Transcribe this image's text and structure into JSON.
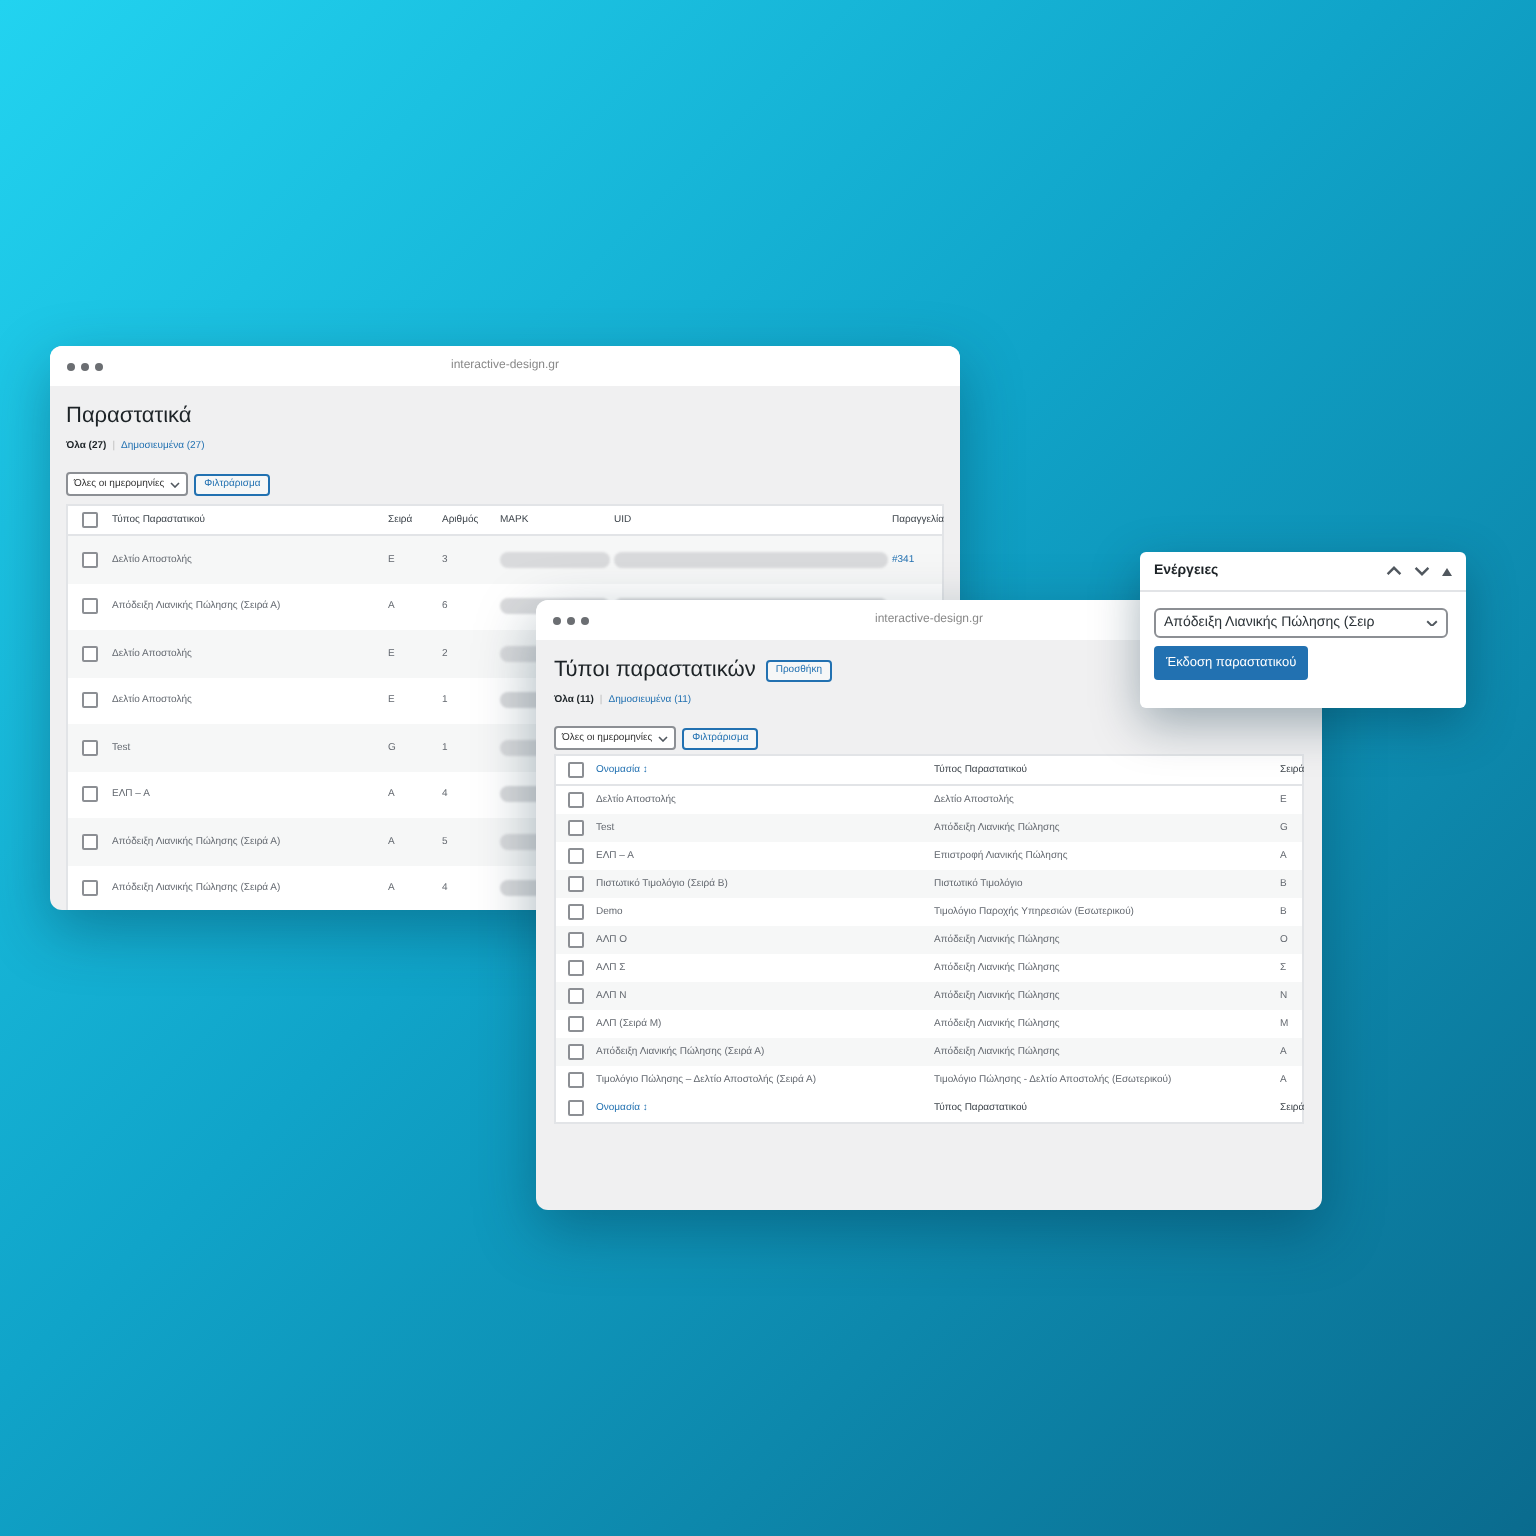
{
  "documents_window": {
    "url": "interactive-design.gr",
    "title": "Παραστατικά",
    "views": [
      {
        "label": "Όλα (27)",
        "selected": true
      },
      {
        "label": "Δημοσιευμένα (27)",
        "selected": false
      }
    ],
    "views_separator": "|",
    "select_all_checked": false,
    "date_filter": "Όλες οι ημερομηνίες",
    "filter_button": "Φιλτράρισμα",
    "columns": [
      "Τύπος Παραστατικού",
      "Σειρά",
      "Αριθμός",
      "ΜΑΡΚ",
      "UID",
      "Παραγγελία"
    ],
    "rows": [
      {
        "type": "Δελτίο Αποστολής",
        "series": "Ε",
        "number": "3",
        "order": "#341",
        "checked": false
      },
      {
        "type": "Απόδειξη Λιανικής Πώλησης (Σειρά Α)",
        "series": "Α",
        "number": "6",
        "checked": false
      },
      {
        "type": "Δελτίο Αποστολής",
        "series": "Ε",
        "number": "2",
        "checked": false
      },
      {
        "type": "Δελτίο Αποστολής",
        "series": "Ε",
        "number": "1",
        "checked": false
      },
      {
        "type": "Test",
        "series": "G",
        "number": "1",
        "checked": false
      },
      {
        "type": "ΕΛΠ – Α",
        "series": "Α",
        "number": "4",
        "checked": false
      },
      {
        "type": "Απόδειξη Λιανικής Πώλησης (Σειρά Α)",
        "series": "Α",
        "number": "5",
        "checked": false
      },
      {
        "type": "Απόδειξη Λιανικής Πώλησης (Σειρά Α)",
        "series": "Α",
        "number": "4",
        "checked": false
      }
    ]
  },
  "types_window": {
    "url": "interactive-design.gr",
    "title": "Τύποι παραστατικών",
    "add_button": "Προσθήκη",
    "views": [
      {
        "label": "Όλα (11)",
        "selected": true
      },
      {
        "label": "Δημοσιευμένα (11)",
        "selected": false
      }
    ],
    "views_separator": "|",
    "select_all_checked": false,
    "footer_select_all_checked": false,
    "date_filter": "Όλες οι ημερομηνίες",
    "filter_button": "Φιλτράρισμα",
    "columns": [
      "Ονομασία ↕",
      "Τύπος Παραστατικού",
      "Σειρά"
    ],
    "rows": [
      {
        "name": "Δελτίο Αποστολής",
        "type": "Δελτίο Αποστολής",
        "series": "Ε",
        "checked": false
      },
      {
        "name": "Test",
        "type": "Απόδειξη Λιανικής Πώλησης",
        "series": "G",
        "checked": false
      },
      {
        "name": "ΕΛΠ – Α",
        "type": "Επιστροφή Λιανικής Πώλησης",
        "series": "Α",
        "checked": false
      },
      {
        "name": "Πιστωτικό Τιμολόγιο (Σειρά Β)",
        "type": "Πιστωτικό Τιμολόγιο",
        "series": "Β",
        "checked": false
      },
      {
        "name": "Demo",
        "type": "Τιμολόγιο Παροχής Υπηρεσιών (Εσωτερικού)",
        "series": "Β",
        "checked": false
      },
      {
        "name": "ΑΛΠ Ο",
        "type": "Απόδειξη Λιανικής Πώλησης",
        "series": "Ο",
        "checked": false
      },
      {
        "name": "ΑΛΠ Σ",
        "type": "Απόδειξη Λιανικής Πώλησης",
        "series": "Σ",
        "checked": false
      },
      {
        "name": "ΑΛΠ Ν",
        "type": "Απόδειξη Λιανικής Πώλησης",
        "series": "Ν",
        "checked": false
      },
      {
        "name": "ΑΛΠ (Σειρά Μ)",
        "type": "Απόδειξη Λιανικής Πώλησης",
        "series": "Μ",
        "checked": false
      },
      {
        "name": "Απόδειξη Λιανικής Πώλησης (Σειρά Α)",
        "type": "Απόδειξη Λιανικής Πώλησης",
        "series": "Α",
        "checked": false
      },
      {
        "name": "Τιμολόγιο Πώλησης – Δελτίο Αποστολής (Σειρά Α)",
        "type": "Τιμολόγιο Πώλησης - Δελτίο Αποστολής (Εσωτερικού)",
        "series": "Α",
        "checked": false
      }
    ],
    "footer_columns": [
      "Ονομασία ↕",
      "Τύπος Παραστατικού",
      "Σειρά"
    ]
  },
  "actions_panel": {
    "title": "Ενέργειες",
    "document_select": "Απόδειξη Λιανικής Πώλησης (Σειρ",
    "issue_button": "Έκδοση παραστατικού"
  }
}
